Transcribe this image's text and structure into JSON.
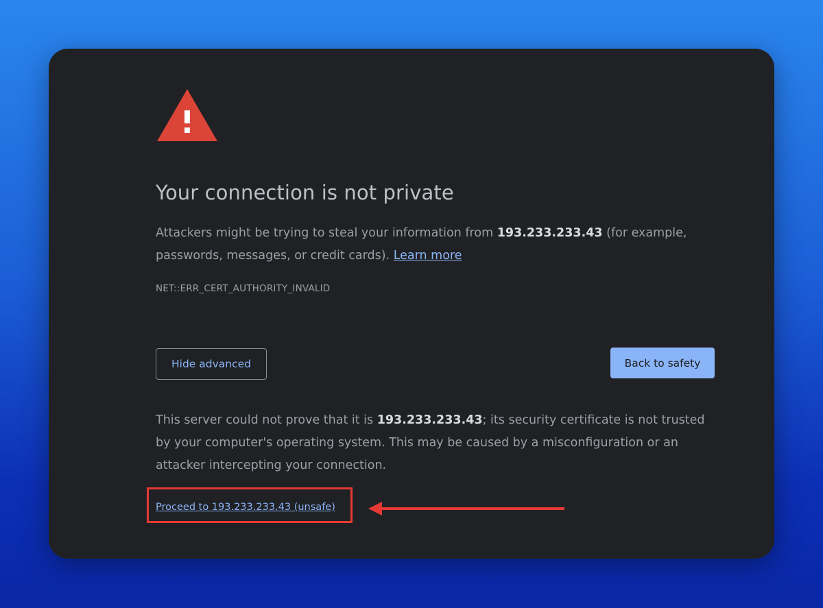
{
  "page": {
    "title": "Your connection is not private",
    "message": {
      "prefix": "Attackers might be trying to steal your information from ",
      "host": "193.233.233.43",
      "suffix": " (for example, passwords, messages, or credit cards). ",
      "learn_more": "Learn more"
    },
    "error_code": "NET::ERR_CERT_AUTHORITY_INVALID",
    "buttons": {
      "hide_advanced": "Hide advanced",
      "back_to_safety": "Back to safety"
    },
    "explanation": {
      "prefix": "This server could not prove that it is ",
      "host": "193.233.233.43",
      "suffix": "; its security certificate is not trusted by your computer's operating system. This may be caused by a misconfiguration or an attacker intercepting your connection."
    },
    "proceed_link": "Proceed to 193.233.233.43 (unsafe)"
  },
  "icons": {
    "warning": "warning-triangle-icon",
    "annotation_arrow": "arrow-left-icon"
  },
  "colors": {
    "background_top": "#2a86ee",
    "background_bottom": "#0a27a6",
    "panel": "#202124",
    "warning": "#db4437",
    "link": "#8ab4f8",
    "annotation": "#e53935"
  }
}
